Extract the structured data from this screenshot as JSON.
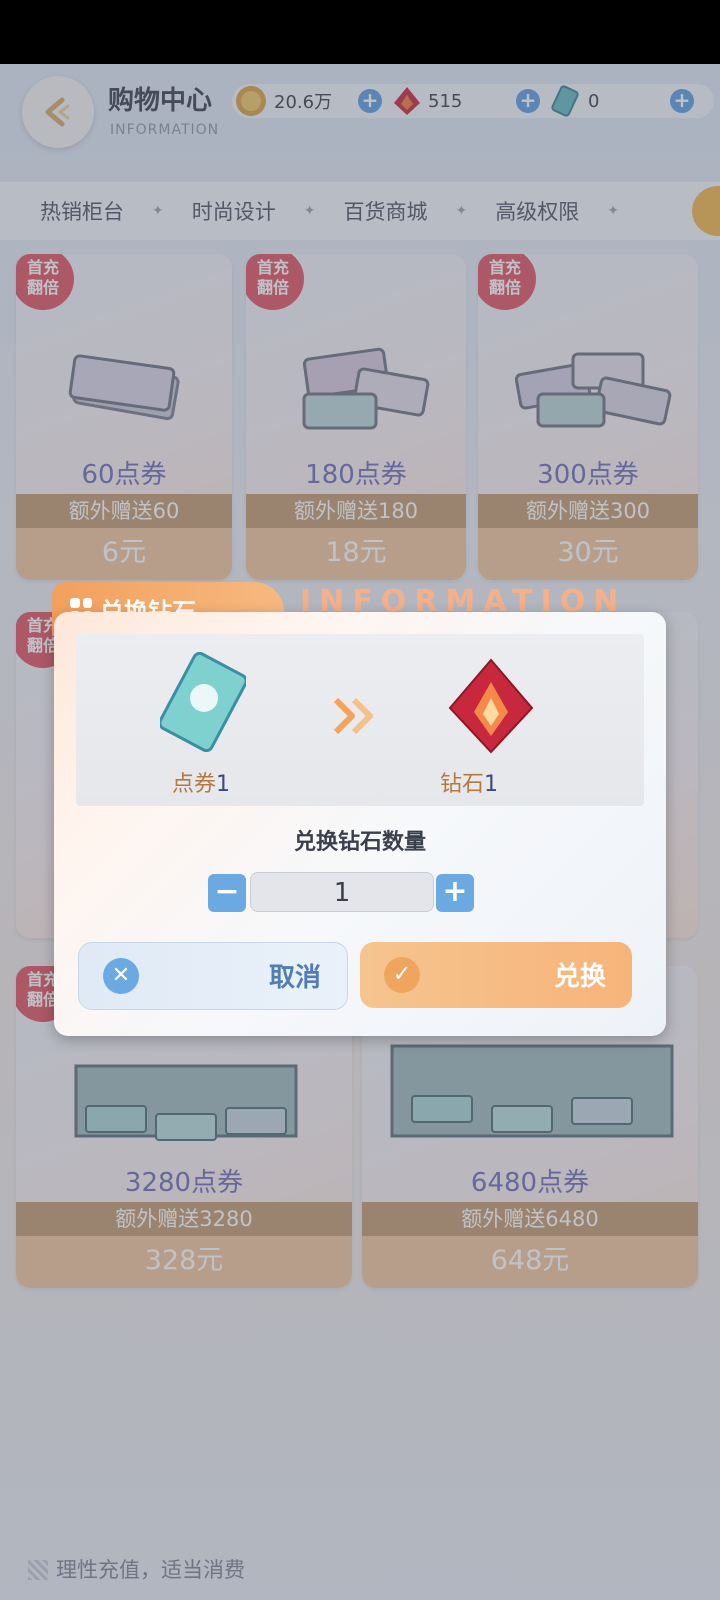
{
  "header": {
    "title": "购物中心",
    "subtitle": "INFORMATION",
    "currency": [
      {
        "icon": "gold-coin-icon",
        "value": "20.6万"
      },
      {
        "icon": "diamond-icon",
        "value": "515"
      },
      {
        "icon": "ticket-icon",
        "value": "0"
      }
    ]
  },
  "tabs": [
    "热销柜台",
    "时尚设计",
    "百货商城",
    "高级权限"
  ],
  "badge_text": "首充\n翻倍",
  "products": [
    {
      "points": "60点券",
      "bonus": "额外赠送60",
      "price": "6元"
    },
    {
      "points": "180点券",
      "bonus": "额外赠送180",
      "price": "18元"
    },
    {
      "points": "300点券",
      "bonus": "额外赠送300",
      "price": "30元"
    },
    {
      "points": "3280点券",
      "bonus": "额外赠送3280",
      "price": "328元"
    },
    {
      "points": "6480点券",
      "bonus": "额外赠送6480",
      "price": "648元"
    }
  ],
  "modal": {
    "title": "兑换钻石",
    "banner_text": "INFORMATION",
    "from_label": "点券",
    "from_qty": "1",
    "to_label": "钻石",
    "to_qty": "1",
    "quantity_title": "兑换钻石数量",
    "quantity": "1",
    "cancel_label": "取消",
    "confirm_label": "兑换"
  },
  "footer": {
    "note": "理性充值，适当消费"
  },
  "colors": {
    "accent_orange": "#f2a05d",
    "accent_blue": "#6aa9e2",
    "badge_red": "#e05561"
  }
}
